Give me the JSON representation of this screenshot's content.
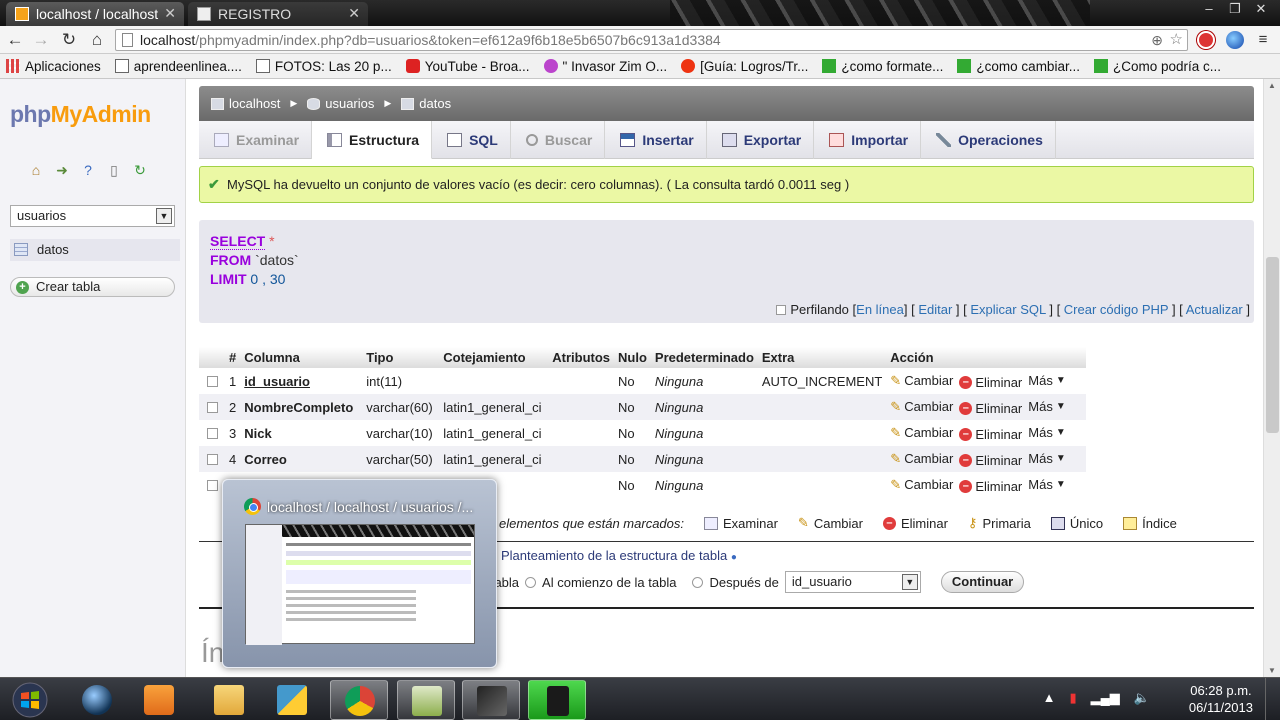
{
  "browser": {
    "tabs": [
      {
        "title": "localhost / localhost"
      },
      {
        "title": "REGISTRO"
      }
    ],
    "window_controls": [
      "‒",
      "❐",
      "✕"
    ],
    "url_host": "localhost",
    "url_path": "/phpmyadmin/index.php?db=usuarios&token=ef612a9f6b18e5b6507b6c913a1d3384",
    "bookmarks": [
      {
        "label": "Aplicaciones",
        "icon": "apps-grid-icon"
      },
      {
        "label": "aprendeenlinea....",
        "icon": "page-icon"
      },
      {
        "label": "FOTOS: Las 20 p...",
        "icon": "page-icon"
      },
      {
        "label": "YouTube - Broa...",
        "icon": "youtube-icon"
      },
      {
        "label": "\" Invasor Zim O...",
        "icon": "site-icon"
      },
      {
        "label": "[Guía: Logros/Tr...",
        "icon": "site-icon"
      },
      {
        "label": "¿como formate...",
        "icon": "green-star-icon"
      },
      {
        "label": "¿como cambiar...",
        "icon": "green-star-icon"
      },
      {
        "label": "¿Como podría c...",
        "icon": "green-star-icon"
      }
    ]
  },
  "sidebar": {
    "logo": {
      "php": "php",
      "myadmin": "MyAdmin"
    },
    "db_selected": "usuarios",
    "table_item": "datos",
    "create_table": "Crear tabla"
  },
  "breadcrumb": [
    "localhost",
    "usuarios",
    "datos"
  ],
  "tabs": [
    {
      "label": "Examinar",
      "state": "disabled"
    },
    {
      "label": "Estructura",
      "state": "active"
    },
    {
      "label": "SQL",
      "state": "normal"
    },
    {
      "label": "Buscar",
      "state": "disabled"
    },
    {
      "label": "Insertar",
      "state": "normal"
    },
    {
      "label": "Exportar",
      "state": "normal"
    },
    {
      "label": "Importar",
      "state": "normal"
    },
    {
      "label": "Operaciones",
      "state": "normal"
    }
  ],
  "message": "MySQL ha devuelto un conjunto de valores vacío (es decir: cero columnas). ( La consulta tardó 0.0011 seg )",
  "sql": {
    "select_kw": "SELECT",
    "select_rest": " *",
    "from_kw": "FROM",
    "from_rest": " `datos`",
    "limit_kw": "LIMIT",
    "limit_rest": " 0 , 30"
  },
  "profiling": {
    "label": "Perfilando",
    "links": [
      "En línea",
      "Editar",
      "Explicar SQL",
      "Crear código PHP",
      "Actualizar"
    ]
  },
  "structure": {
    "headers": [
      "#",
      "Columna",
      "Tipo",
      "Cotejamiento",
      "Atributos",
      "Nulo",
      "Predeterminado",
      "Extra",
      "Acción"
    ],
    "rows": [
      {
        "num": "1",
        "name": "id_usuario",
        "type": "int(11)",
        "collation": "",
        "attrs": "",
        "null": "No",
        "default": "Ninguna",
        "extra": "AUTO_INCREMENT"
      },
      {
        "num": "2",
        "name": "NombreCompleto",
        "type": "varchar(60)",
        "collation": "latin1_general_ci",
        "attrs": "",
        "null": "No",
        "default": "Ninguna",
        "extra": ""
      },
      {
        "num": "3",
        "name": "Nick",
        "type": "varchar(10)",
        "collation": "latin1_general_ci",
        "attrs": "",
        "null": "No",
        "default": "Ninguna",
        "extra": ""
      },
      {
        "num": "4",
        "name": "Correo",
        "type": "varchar(50)",
        "collation": "latin1_general_ci",
        "attrs": "",
        "null": "No",
        "default": "Ninguna",
        "extra": ""
      },
      {
        "num": "",
        "name": "",
        "type": "",
        "collation": "eneral_ci",
        "attrs": "",
        "null": "No",
        "default": "Ninguna",
        "extra": ""
      }
    ],
    "actions": {
      "change": "Cambiar",
      "delete": "Eliminar",
      "more": "Más"
    }
  },
  "bulk": {
    "label": "elementos que están marcados:",
    "actions": [
      "Examinar",
      "Cambiar",
      "Eliminar",
      "Primaria",
      "Único",
      "Índice"
    ]
  },
  "planteamiento": "Planteamiento de la estructura de tabla",
  "add_columns": {
    "end_label": "a tabla",
    "start_label": "Al comienzo de la tabla",
    "after_label": "Después de",
    "after_value": "id_usuario",
    "button": "Continuar"
  },
  "heading2": "Ín",
  "preview": {
    "title": "localhost / localhost / usuarios /..."
  },
  "taskbar": {
    "time": "06:28 p.m.",
    "date": "06/11/2013"
  }
}
